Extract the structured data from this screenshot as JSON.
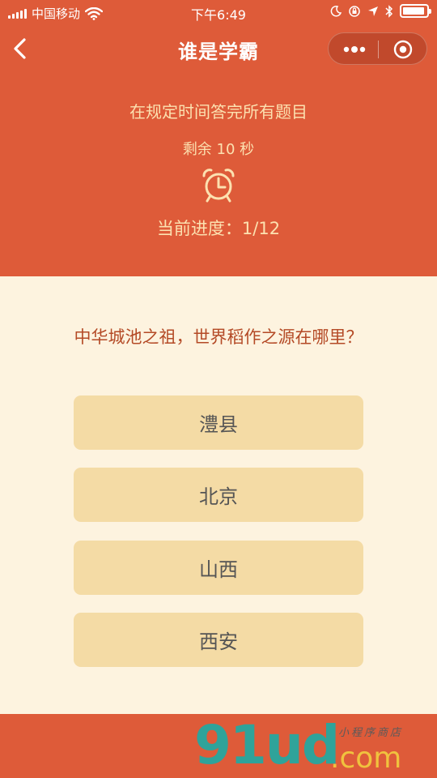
{
  "status_bar": {
    "carrier": "中国移动",
    "time": "下午6:49"
  },
  "nav": {
    "title": "谁是学霸",
    "icons": [
      "back-arrow-icon",
      "more-dots-icon",
      "target-icon"
    ]
  },
  "quiz": {
    "instruction": "在规定时间答完所有题目",
    "remaining": "剩余 10 秒",
    "progress": "当前进度：1/12",
    "question": "中华城池之祖，世界稻作之源在哪里？",
    "options": [
      "澧县",
      "北京",
      "山西",
      "西安"
    ]
  },
  "watermark": {
    "main": "91ud",
    "suffix": ".com",
    "tagline": "小程序商店"
  },
  "colors": {
    "header": "#DE5B39",
    "background": "#FDF3DF",
    "option": "#F4DBA5",
    "question": "#B44A26",
    "info_text": "#FCE1B0"
  }
}
